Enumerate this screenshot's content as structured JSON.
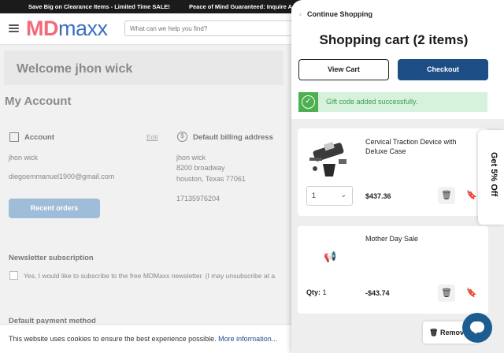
{
  "promo": {
    "item1": "Save Big on Clearance Items - Limited Time SALE!",
    "item2": "Peace of Mind Guaranteed: Inquire A"
  },
  "header": {
    "logo_part1": "MD",
    "logo_part2": "maxx",
    "search_placeholder": "What can we help you find?"
  },
  "account": {
    "welcome": "Welcome jhon wick",
    "title": "My Account",
    "account_heading": "Account",
    "edit_label": "Edit",
    "name": "jhon wick",
    "email": "diegoemmanuel1900@gmail.com",
    "recent_orders": "Recent orders",
    "billing_heading": "Default billing address",
    "billing_name": "jhon wick",
    "billing_street": "8200 broadway",
    "billing_city": "houston, Texas 77061",
    "billing_phone": "17135976204",
    "newsletter_heading": "Newsletter subscription",
    "newsletter_text": "Yes, I would like to subscribe to the free MDMaxx newsletter. (I may unsubscribe at a",
    "payment_heading": "Default payment method"
  },
  "cookie": {
    "text": "This website uses cookies to ensure the best experience possible.",
    "link": "More information..."
  },
  "cart": {
    "continue_label": "Continue Shopping",
    "title": "Shopping cart (2 items)",
    "view_cart": "View Cart",
    "checkout": "Checkout",
    "gift_message": "Gift code added successfully.",
    "items": [
      {
        "name": "Cervical Traction Device with Deluxe Case",
        "price": "$437.36",
        "qty": "1"
      },
      {
        "name": "Mother Day Sale",
        "price": "-$43.74",
        "qty_label": "Qty:",
        "qty": "1"
      }
    ],
    "remove_label": "Remove",
    "discount_tab": "Get 5% Off"
  },
  "colors": {
    "accent": "#1c4e85",
    "success": "#4caf50",
    "logo_pink": "#f36a7a",
    "logo_blue": "#3a6fc0"
  },
  "icons": {
    "back": "chevron-left-icon",
    "gift_check": "check-circle-icon",
    "trash": "trash-icon",
    "bookmark": "bookmark-icon",
    "megaphone": "megaphone-icon",
    "chat": "chat-icon"
  }
}
